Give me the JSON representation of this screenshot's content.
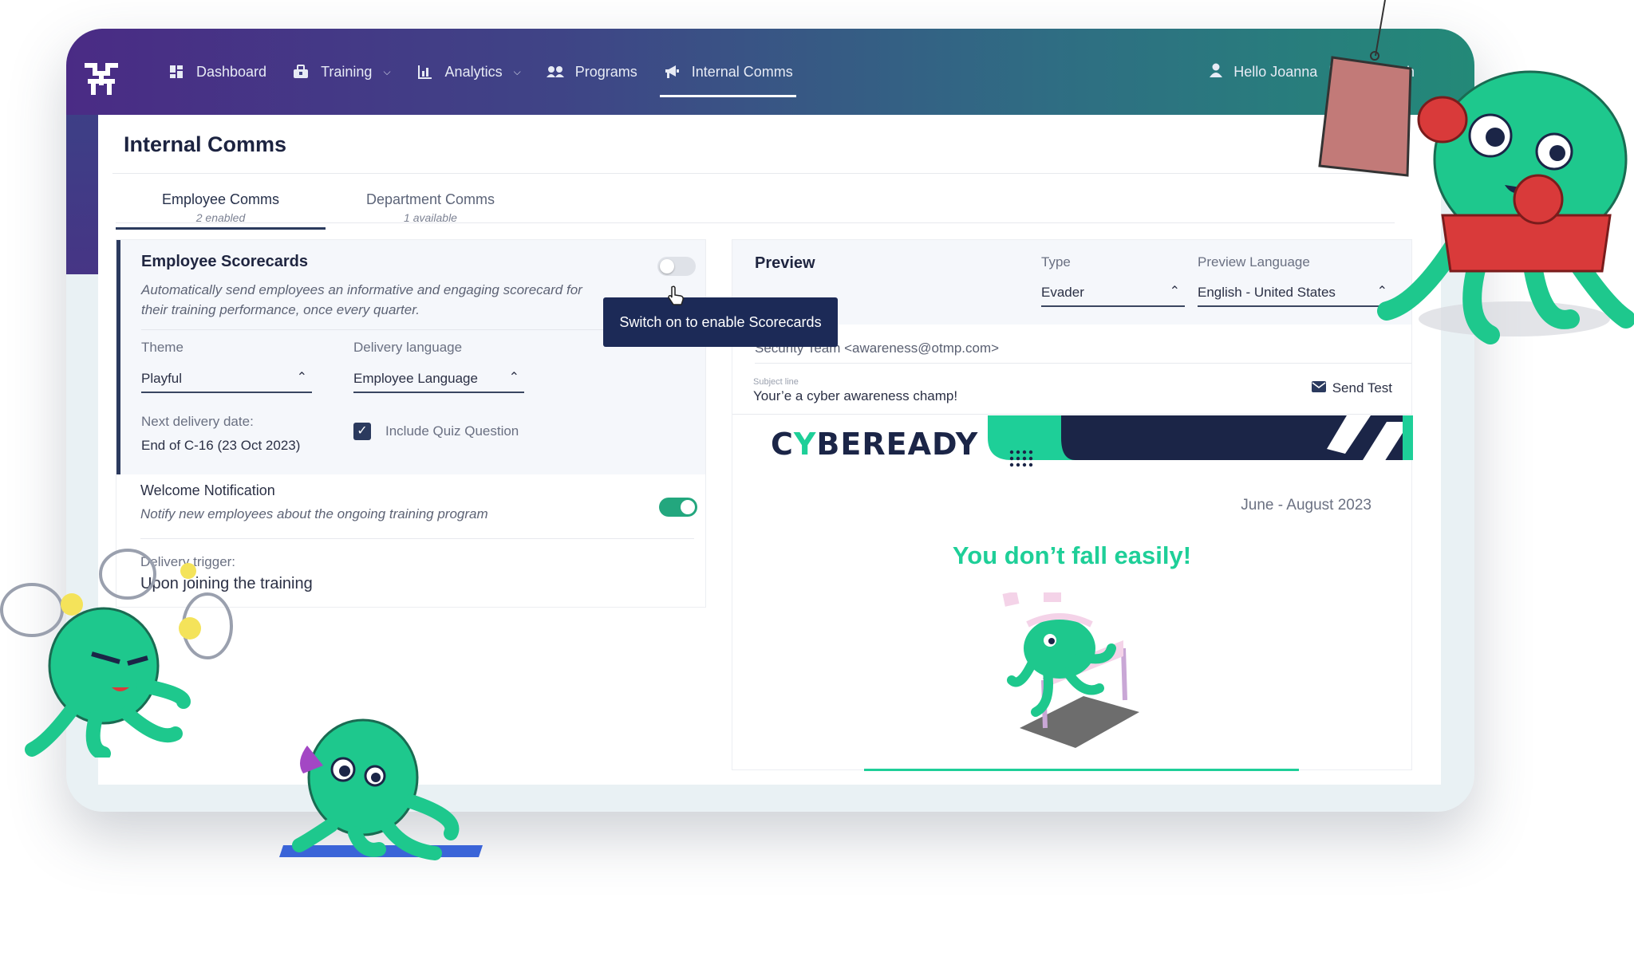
{
  "nav": {
    "items": [
      {
        "label": "Dashboard",
        "icon": "dashboard-icon",
        "has_dropdown": false
      },
      {
        "label": "Training",
        "icon": "training-icon",
        "has_dropdown": true
      },
      {
        "label": "Analytics",
        "icon": "analytics-icon",
        "has_dropdown": true
      },
      {
        "label": "Programs",
        "icon": "programs-icon",
        "has_dropdown": false
      },
      {
        "label": "Internal Comms",
        "icon": "megaphone-icon",
        "has_dropdown": false,
        "active": true
      }
    ],
    "user_greeting": "Hello Joanna",
    "separator": "|",
    "trailing_text": "ch"
  },
  "page": {
    "title": "Internal Comms"
  },
  "tabs": [
    {
      "label": "Employee Comms",
      "sub": "2 enabled",
      "active": true
    },
    {
      "label": "Department Comms",
      "sub": "1 available",
      "active": false
    }
  ],
  "scorecard": {
    "title": "Employee Scorecards",
    "description": "Automatically send employees an informative and engaging scorecard for their training performance, once every quarter.",
    "enabled": false,
    "theme_label": "Theme",
    "theme_value": "Playful",
    "delivery_lang_label": "Delivery language",
    "delivery_lang_value": "Employee Language",
    "next_delivery_label": "Next delivery date:",
    "next_delivery_value": "End of C-16 (23 Oct 2023)",
    "include_quiz_label": "Include Quiz Question",
    "include_quiz_checked": true
  },
  "tooltip": {
    "text": "Switch on to enable Scorecards"
  },
  "welcome": {
    "title": "Welcome Notification",
    "description": "Notify new employees about the ongoing training program",
    "enabled": true,
    "trigger_label": "Delivery trigger:",
    "trigger_value": "Upon joining the training"
  },
  "preview": {
    "title": "Preview",
    "type_label": "Type",
    "type_value": "Evader",
    "lang_label": "Preview Language",
    "lang_value": "English - United States",
    "from": "Security Team <awareness@otmp.com>",
    "subject_label": "Subject line",
    "subject_value": "Your’e a cyber awareness champ!",
    "send_test_label": "Send Test"
  },
  "email": {
    "brand_pre": "C",
    "brand_mark": "Y",
    "brand_post": "BEREADY",
    "period": "June - August 2023",
    "headline": "You don’t fall easily!"
  },
  "colors": {
    "nav_gradient_start": "#4a2b85",
    "nav_gradient_end": "#238978",
    "primary_dark": "#2b3a5e",
    "tooltip_bg": "#1c2a57",
    "accent_green": "#1ecf98",
    "toggle_on": "#23a77e"
  }
}
